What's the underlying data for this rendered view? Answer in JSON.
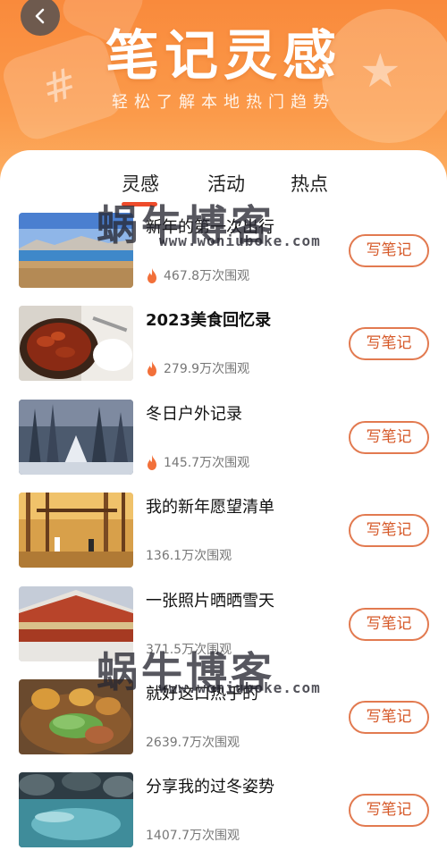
{
  "header": {
    "title": "笔记灵感",
    "subtitle": "轻松了解本地热门趋势"
  },
  "tabs": [
    {
      "label": "灵感",
      "active": true
    },
    {
      "label": "活动",
      "active": false
    },
    {
      "label": "热点",
      "active": false
    }
  ],
  "write_label": "写笔记",
  "items": [
    {
      "title": "新年的第一次出行",
      "views": "467.8万次围观",
      "hot": true,
      "bold": false
    },
    {
      "title": "2023美食回忆录",
      "views": "279.9万次围观",
      "hot": true,
      "bold": true
    },
    {
      "title": "冬日户外记录",
      "views": "145.7万次围观",
      "hot": true,
      "bold": false
    },
    {
      "title": "我的新年愿望清单",
      "views": "136.1万次围观",
      "hot": false,
      "bold": false
    },
    {
      "title": "一张照片晒晒雪天",
      "views": "371.5万次围观",
      "hot": false,
      "bold": false
    },
    {
      "title": "就好这口热乎的",
      "views": "2639.7万次围观",
      "hot": false,
      "bold": false
    },
    {
      "title": "分享我的过冬姿势",
      "views": "1407.7万次围观",
      "hot": false,
      "bold": false
    }
  ],
  "watermark": {
    "cn": "蜗牛博客",
    "en": "www.woniuboke.com"
  },
  "colors": {
    "header_orange": "#f98a3c",
    "accent_red": "#ee4b2b",
    "button_border": "#e27a50",
    "fire": "#f2703a"
  },
  "icons": {
    "back": "chevron-left-icon",
    "hot": "fire-icon"
  }
}
